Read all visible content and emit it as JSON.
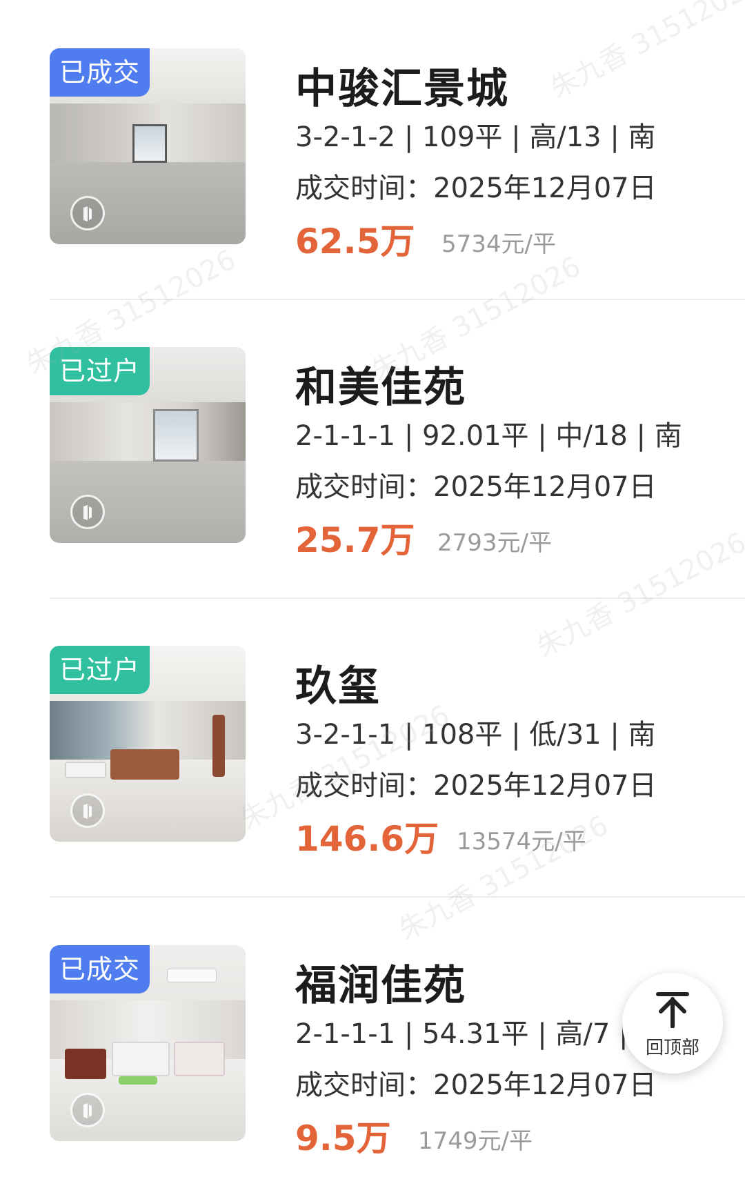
{
  "listings": [
    {
      "status": "已成交",
      "status_color": "#4f7df0",
      "title": "中骏汇景城",
      "specs": "3-2-1-2 | 109平 | 高/13 | 南",
      "deal_time": "成交时间：2025年12月07日",
      "price": "62.5万",
      "unit_price": "5734元/平",
      "icon": "vr-360-icon"
    },
    {
      "status": "已过户",
      "status_color": "#30c0a0",
      "title": "和美佳苑",
      "specs": "2-1-1-1 | 92.01平 | 中/18 | 南",
      "deal_time": "成交时间：2025年12月07日",
      "price": "25.7万",
      "unit_price": "2793元/平",
      "icon": "vr-360-icon"
    },
    {
      "status": "已过户",
      "status_color": "#30c0a0",
      "title": "玖玺",
      "specs": "3-2-1-1 | 108平 | 低/31 | 南",
      "deal_time": "成交时间：2025年12月07日",
      "price": "146.6万",
      "unit_price": "13574元/平",
      "icon": "vr-360-icon"
    },
    {
      "status": "已成交",
      "status_color": "#4f7df0",
      "title": "福润佳苑",
      "specs": "2-1-1-1 | 54.31平 | 高/7 | 南",
      "deal_time": "成交时间：2025年12月07日",
      "price": "9.5万",
      "unit_price": "1749元/平",
      "icon": "vr-360-icon"
    }
  ],
  "back_to_top": {
    "label": "回顶部",
    "icon": "arrow-up-icon"
  },
  "watermark": "朱九香 31512026"
}
